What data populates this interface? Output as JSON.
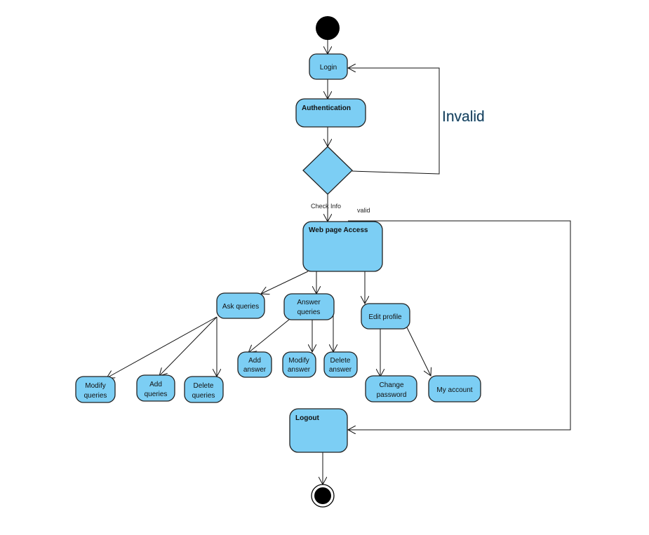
{
  "diagram": {
    "type": "uml-activity",
    "fill_color": "#7ccef4",
    "nodes": {
      "login": "Login",
      "authentication": "Authentication",
      "web_page_access": "Web page Access",
      "ask_queries": "Ask queries",
      "answer_queries": [
        "Answer",
        "queries"
      ],
      "edit_profile": "Edit profile",
      "add_answer": [
        "Add",
        "answer"
      ],
      "modify_answer": [
        "Modify",
        "answer"
      ],
      "delete_answer": [
        "Delete",
        "answer"
      ],
      "modify_queries": [
        "Modify",
        "queries"
      ],
      "add_queries": [
        "Add",
        "queries"
      ],
      "delete_queries": [
        "Delete",
        "queries"
      ],
      "change_password": [
        "Change",
        "password"
      ],
      "my_account": "My account",
      "logout": "Logout"
    },
    "edge_labels": {
      "invalid": "Invalid",
      "check_info": "Check Info",
      "valid": "valid"
    }
  }
}
